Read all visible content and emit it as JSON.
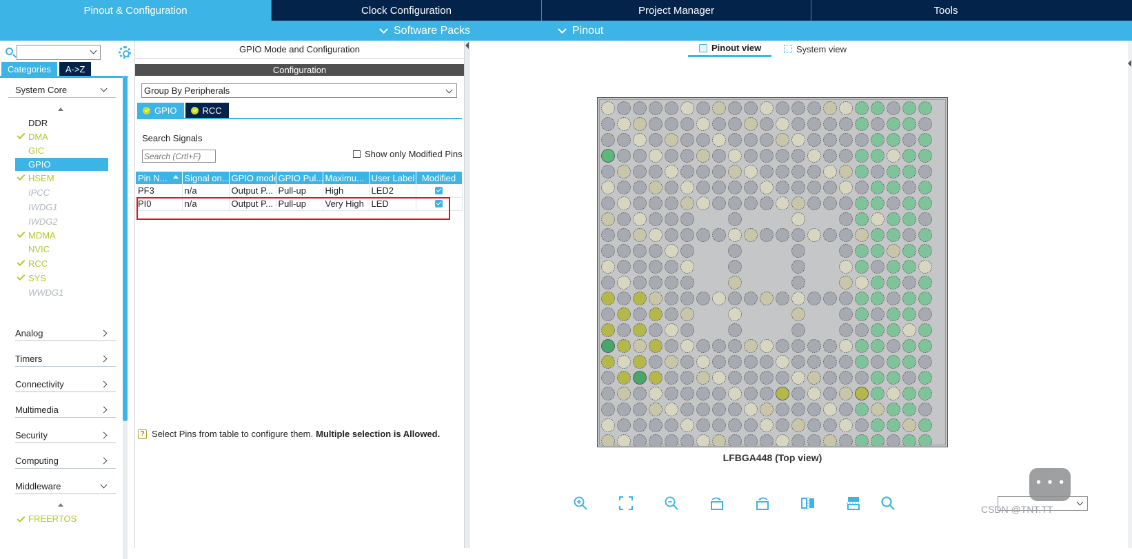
{
  "top_tabs": [
    {
      "label": "Pinout & Configuration",
      "active": true
    },
    {
      "label": "Clock Configuration",
      "active": false
    },
    {
      "label": "Project Manager",
      "active": false
    },
    {
      "label": "Tools",
      "active": false
    }
  ],
  "sub_menu": {
    "software_packs": "Software Packs",
    "pinout": "Pinout"
  },
  "left": {
    "tab_categories": "Categories",
    "tab_az": "A->Z",
    "system_core": {
      "title": "System Core",
      "items": [
        {
          "label": "DDR",
          "state": "normal",
          "checked": false
        },
        {
          "label": "DMA",
          "state": "green",
          "checked": true
        },
        {
          "label": "GIC",
          "state": "green",
          "checked": false
        },
        {
          "label": "GPIO",
          "state": "selected",
          "checked": false
        },
        {
          "label": "HSEM",
          "state": "green",
          "checked": true
        },
        {
          "label": "IPCC",
          "state": "disabled",
          "checked": false
        },
        {
          "label": "IWDG1",
          "state": "disabled",
          "checked": false
        },
        {
          "label": "IWDG2",
          "state": "disabled",
          "checked": false
        },
        {
          "label": "MDMA",
          "state": "green",
          "checked": true
        },
        {
          "label": "NVIC",
          "state": "green",
          "checked": false
        },
        {
          "label": "RCC",
          "state": "green",
          "checked": true
        },
        {
          "label": "SYS",
          "state": "green",
          "checked": true
        },
        {
          "label": "WWDG1",
          "state": "disabled",
          "checked": false
        }
      ]
    },
    "sections": [
      "Analog",
      "Timers",
      "Connectivity",
      "Multimedia",
      "Security",
      "Computing",
      "Middleware"
    ],
    "partial_item": "FREERTOS"
  },
  "middle": {
    "title": "GPIO Mode and Configuration",
    "configuration": "Configuration",
    "group_by": "Group By Peripherals",
    "tabs": [
      "GPIO",
      "RCC"
    ],
    "search_signals": "Search Signals",
    "search_placeholder": "Search (Crtl+F)",
    "show_modified": "Show only Modified Pins",
    "columns": [
      "Pin N...",
      "Signal on...",
      "GPIO mode",
      "GPIO Pul...",
      "Maximu...",
      "User Label",
      "Modified"
    ],
    "rows": [
      {
        "pin": "PF3",
        "signal": "n/a",
        "mode": "Output P...",
        "pull": "Pull-up",
        "speed": "High",
        "label": "LED2",
        "modified": true
      },
      {
        "pin": "PI0",
        "signal": "n/a",
        "mode": "Output P...",
        "pull": "Pull-up",
        "speed": "Very High",
        "label": "LED",
        "modified": true
      }
    ],
    "hint_text": "Select Pins from table to configure them.",
    "hint_bold": "Multiple selection is Allowed."
  },
  "right": {
    "pinout_view": "Pinout view",
    "system_view": "System view",
    "package_label": "LFBGA448 (Top view)",
    "watermark": "CSDN @TNT.TT"
  },
  "colors": {
    "topbar": "#03234b",
    "accent": "#3cb4e6",
    "green_label": "#b4c72a",
    "highlight": "#e0141e"
  }
}
